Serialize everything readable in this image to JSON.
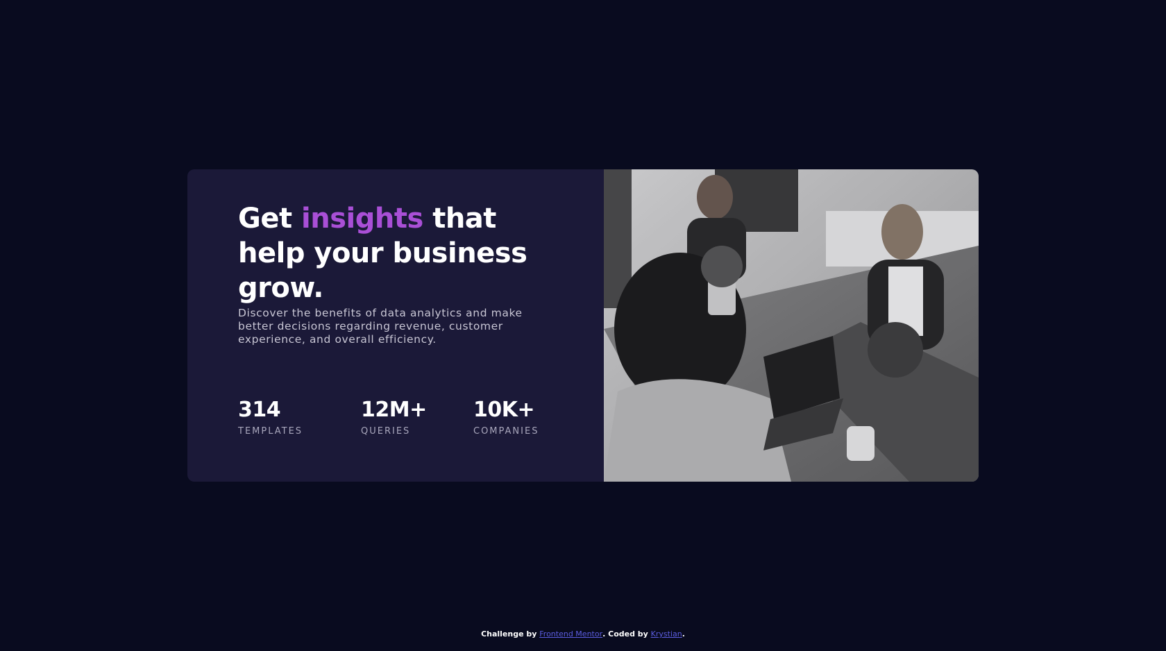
{
  "card": {
    "headline_start": "Get ",
    "headline_accent": "insights",
    "headline_end": " that help your business grow.",
    "description": "Discover the benefits of data analytics and make better decisions regarding revenue, customer experience, and overall efficiency.",
    "stats": [
      {
        "value": "314",
        "label": "TEMPLATES"
      },
      {
        "value": "12M+",
        "label": "QUERIES"
      },
      {
        "value": "10K+",
        "label": "COMPANIES"
      }
    ],
    "image": {
      "alt": "office"
    }
  },
  "footer": {
    "challenge_prefix": "Challenge by ",
    "challenge_link": "Frontend Mentor",
    "coded_prefix": ". Coded by ",
    "coded_link": "Krystian",
    "suffix": "."
  },
  "colors": {
    "page_background": "#090b1f",
    "card_background": "#1b1938",
    "accent": "#a94fd6",
    "link": "#5b5de0"
  }
}
